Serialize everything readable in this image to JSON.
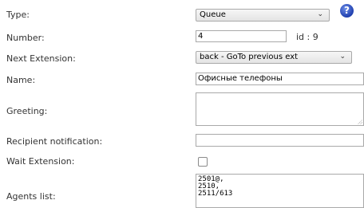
{
  "form": {
    "type": {
      "label": "Type:",
      "value": "Queue"
    },
    "number": {
      "label": "Number:",
      "value": "4",
      "id_text": "id : 9"
    },
    "next_extension": {
      "label": "Next Extension:",
      "value": "back - GoTo previous ext"
    },
    "name": {
      "label": "Name:",
      "value": "Офисные телефоны"
    },
    "greeting": {
      "label": "Greeting:",
      "value": ""
    },
    "recipient_notification": {
      "label": "Recipient notification:",
      "value": ""
    },
    "wait_extension": {
      "label": "Wait Extension:",
      "checked": false
    },
    "agents_list": {
      "label": "Agents list:",
      "value": "2501@,\n2510,\n2511/613"
    }
  },
  "help": {
    "icon": "help-icon",
    "glyph": "?"
  },
  "icons": {
    "chevron": "chevron-down-icon",
    "chevron_glyph": "⌄"
  }
}
